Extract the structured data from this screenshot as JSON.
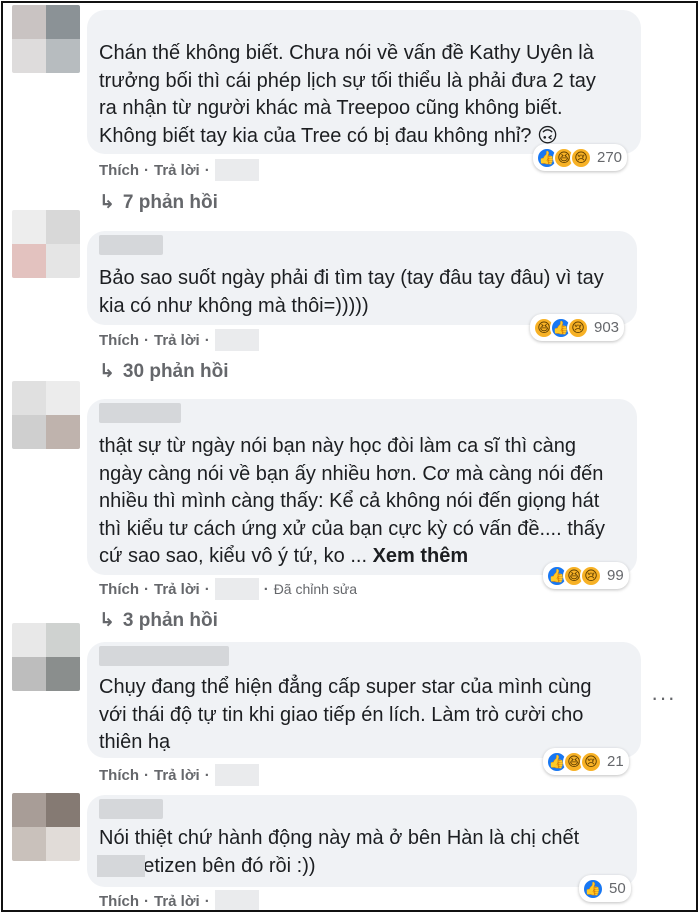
{
  "comments": [
    {
      "text": "Chán thế không biết. Chưa nói về vấn đề Kathy Uyên là\ntrưởng bối thì cái phép lịch sự tối thiểu là phải đưa 2 tay\nra nhận từ người khác mà Treepoo cũng không biết.\nKhông biết tay kia của Tree có bị đau không nhỉ? 🙃",
      "like": "Thích",
      "reply": "Trả lời",
      "reactions": [
        "like-icon",
        "haha-icon",
        "sad-icon"
      ],
      "reaction_count": "270",
      "replies_label": "7 phản hồi"
    },
    {
      "text": "Bảo sao suốt ngày phải đi tìm tay (tay đâu tay đâu) vì tay\nkia có như không mà thôi=)))))",
      "like": "Thích",
      "reply": "Trả lời",
      "reactions": [
        "haha-icon",
        "like-icon",
        "sad-icon"
      ],
      "reaction_count": "903",
      "replies_label": "30 phản hồi"
    },
    {
      "text": "thật sự từ ngày nói bạn này học đòi làm ca sĩ thì càng\nngày càng nói về bạn ấy nhiều hơn. Cơ mà càng nói đến\nnhiều thì mình càng thấy: Kể cả không nói đến giọng hát\nthì kiểu tư cách ứng xử của bạn cực kỳ có vấn đề.... thấy\ncứ sao sao, kiểu vô ý tứ, ko ... ",
      "see_more": "Xem thêm",
      "like": "Thích",
      "reply": "Trả lời",
      "edited": "Đã chỉnh sửa",
      "reactions": [
        "like-icon",
        "haha-icon",
        "sad-icon"
      ],
      "reaction_count": "99",
      "replies_label": "3 phản hồi"
    },
    {
      "text": "Chụy đang thể hiện đẳng cấp super star của mình cùng\nvới thái độ tự tin khi giao tiếp én lích. Làm trò cười cho\nthiên hạ",
      "like": "Thích",
      "reply": "Trả lời",
      "reactions": [
        "like-icon",
        "haha-icon",
        "sad-icon"
      ],
      "reaction_count": "21"
    },
    {
      "text": "Nói thiệt chứ hành động này mà ở bên Hàn là chị chết\n          với netizen bên đó rồi :))",
      "like": "Thích",
      "reply": "Trả lời",
      "reactions": [
        "like-icon"
      ],
      "reaction_count": "50"
    }
  ],
  "more_options": "···",
  "colors": {
    "bubble": "#f0f2f5",
    "meta": "#65676b",
    "like_blue": "#1877f2",
    "emoji_yellow": "#f7b125"
  }
}
